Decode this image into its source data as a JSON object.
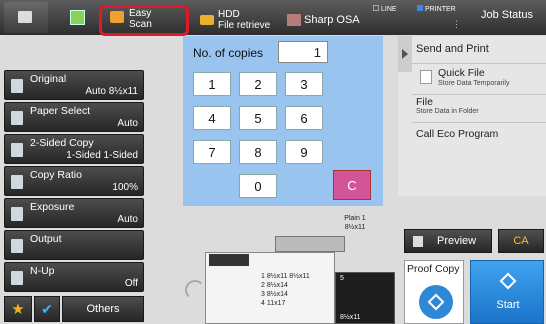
{
  "topbar": {
    "easy_scan_l1": "Easy",
    "easy_scan_l2": "Scan",
    "hdd_l1": "HDD",
    "hdd_l2": "File retrieve",
    "sharp_osa": "Sharp OSA",
    "line": "LINE",
    "printer": "PRINTER",
    "job_status": "Job Status"
  },
  "left": {
    "original_label": "Original",
    "original_value": "Auto  8½x11",
    "paper_label": "Paper Select",
    "paper_value": "Auto",
    "sided_label": "2-Sided Copy",
    "sided_value": "1-Sided 1-Sided",
    "ratio_label": "Copy Ratio",
    "ratio_value": "100%",
    "exposure_label": "Exposure",
    "exposure_value": "Auto",
    "output_label": "Output",
    "nup_label": "N-Up",
    "nup_value": "Off",
    "others_label": "Others"
  },
  "keypad": {
    "copies_label": "No. of copies",
    "copies_value": "1",
    "k1": "1",
    "k2": "2",
    "k3": "3",
    "k4": "4",
    "k5": "5",
    "k6": "6",
    "k7": "7",
    "k8": "8",
    "k9": "9",
    "k0": "0",
    "kc": "C"
  },
  "right": {
    "send_print": "Send and Print",
    "quick_file": "Quick File",
    "quick_file_sub": "Store Data Temporarily",
    "file": "File",
    "file_sub": "Store Data in Folder",
    "eco": "Call Eco Program"
  },
  "actions": {
    "preview": "Preview",
    "ca": "CA",
    "proof_copy": "Proof Copy",
    "start": "Start"
  },
  "machine": {
    "plain": "Plain 1",
    "plain_size": "8½x11",
    "tray1": "1  8½x11  8½x11",
    "tray2": "2  8½x14",
    "tray3": "3  8½x14",
    "tray4": "4  11x17",
    "side_num": "5",
    "side_size": "8½x11"
  }
}
